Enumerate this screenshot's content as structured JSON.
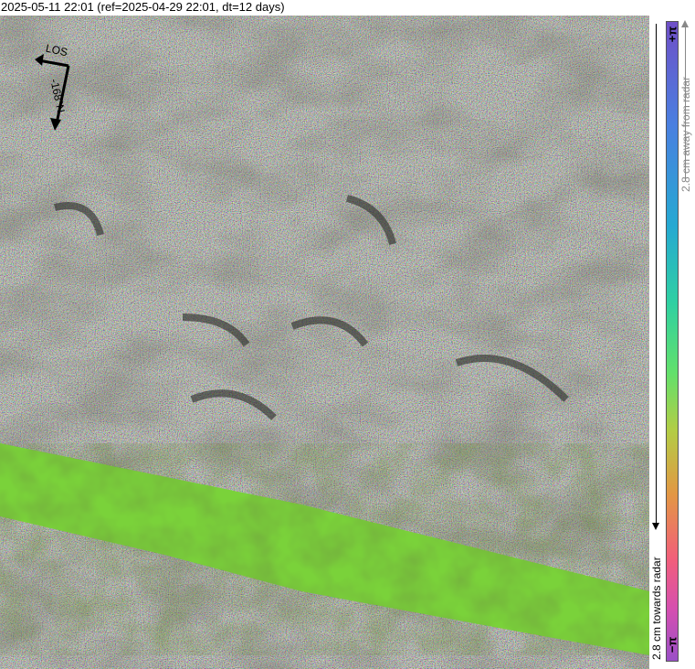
{
  "header": {
    "title": "2025-05-11 22:01 (ref=2025-04-29 22:01, dt=12 days)"
  },
  "map": {
    "los_label": "LOS",
    "heading_label": "-168°N",
    "colors": {
      "noise_base": "#6a7a55",
      "green_band": "#7ad23a",
      "shadow": "#2a2a26"
    }
  },
  "colorbar": {
    "top_label": "+π",
    "bottom_label": "−π",
    "away_label": "2.8 cm away from radar",
    "towards_label": "2.8 cm towards radar",
    "colors": [
      "#6f4fc7",
      "#4a7fe0",
      "#25a9d2",
      "#2fd0a2",
      "#63e06b",
      "#b3cd45",
      "#e39744",
      "#f25f7a",
      "#d54fb0",
      "#9a4fc7"
    ]
  }
}
